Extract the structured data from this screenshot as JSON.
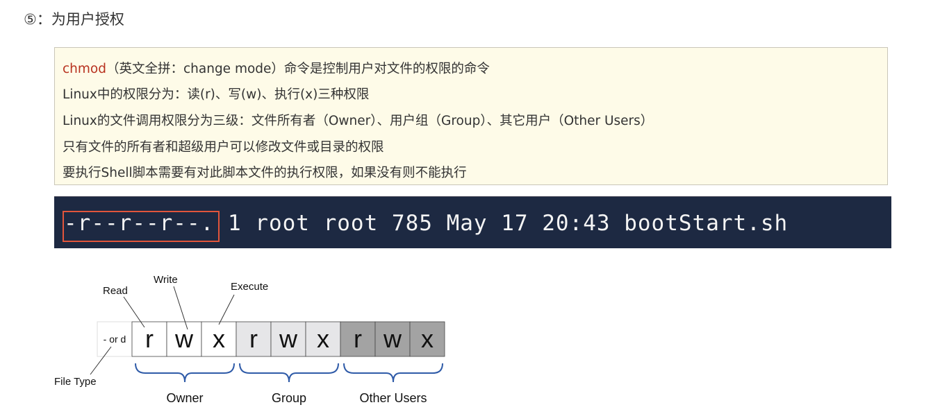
{
  "heading": "⑤：为用户授权",
  "note": {
    "line1_cmd": "chmod",
    "line1_rest": "（英文全拼：change mode）命令是控制用户对文件的权限的命令",
    "line2": "Linux中的权限分为：读(r)、写(w)、执行(x)三种权限",
    "line3": "Linux的文件调用权限分为三级：文件所有者（Owner）、用户组（Group）、其它用户（Other Users）",
    "line4": "只有文件的所有者和超级用户可以修改文件或目录的权限",
    "line5": "要执行Shell脚本需要有对此脚本文件的执行权限，如果没有则不能执行"
  },
  "terminal": {
    "text": "-r--r--r--. 1 root root 785 May 17 20:43 bootStart.sh"
  },
  "diagram": {
    "file_type_cell": "- or d",
    "labels": {
      "read": "Read",
      "write": "Write",
      "execute": "Execute",
      "file_type": "File Type"
    },
    "cells": [
      "r",
      "w",
      "x",
      "r",
      "w",
      "x",
      "r",
      "w",
      "x"
    ],
    "groups": [
      "Owner",
      "Group",
      "Other Users"
    ],
    "colors": {
      "owner": "#ffffff",
      "group": "#e6e6e8",
      "other": "#a3a3a3",
      "brace": "#2f5ba8"
    }
  }
}
